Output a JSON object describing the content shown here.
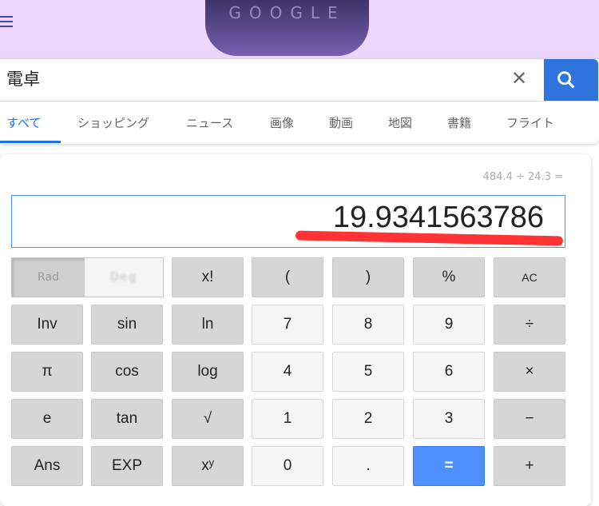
{
  "header": {
    "doodle_text": "GOOGLE"
  },
  "search": {
    "query": "電卓",
    "clear_icon": "close-icon",
    "search_icon": "search-icon"
  },
  "tabs": [
    "すべて",
    "ショッピング",
    "ニュース",
    "画像",
    "動画",
    "地図",
    "書籍",
    "フライト"
  ],
  "calculator": {
    "history": "484.4 ÷ 24.3 =",
    "result": "19.9341563786",
    "angle_mode": {
      "selected": "Rad",
      "other": "Deg"
    },
    "rows": [
      [
        "x!",
        "(",
        ")",
        "%",
        "AC"
      ],
      [
        "Inv",
        "sin",
        "ln",
        "7",
        "8",
        "9",
        "÷"
      ],
      [
        "π",
        "cos",
        "log",
        "4",
        "5",
        "6",
        "×"
      ],
      [
        "e",
        "tan",
        "√",
        "1",
        "2",
        "3",
        "−"
      ],
      [
        "Ans",
        "EXP",
        "xʸ",
        "0",
        ".",
        "=",
        "+"
      ]
    ]
  },
  "colors": {
    "accent": "#4d90fe",
    "annotation": "#ff3333",
    "header_bg": "#ecd6fb"
  }
}
